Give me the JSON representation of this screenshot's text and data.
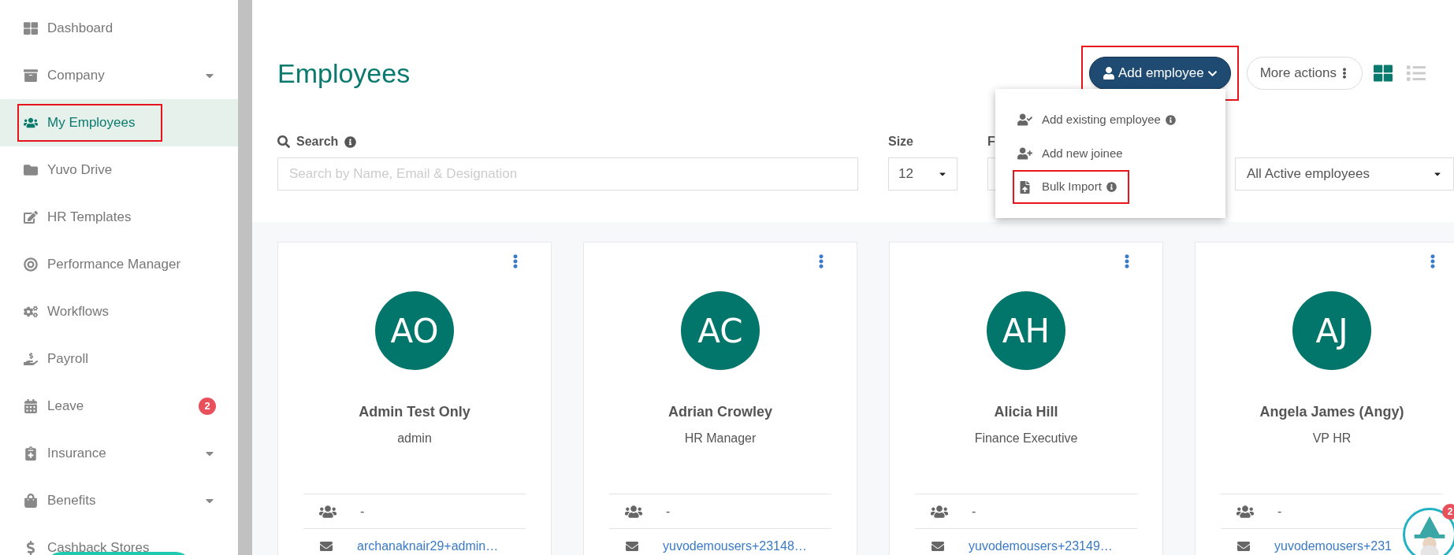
{
  "sidebar": {
    "items": [
      {
        "label": "Dashboard",
        "selected": false,
        "has_submenu": false,
        "highlighted": false
      },
      {
        "label": "Company",
        "selected": false,
        "has_submenu": true,
        "highlighted": false
      },
      {
        "label": "My Employees",
        "selected": true,
        "has_submenu": false,
        "highlighted": true
      },
      {
        "label": "Yuvo Drive",
        "selected": false,
        "has_submenu": false,
        "highlighted": false
      },
      {
        "label": "HR Templates",
        "selected": false,
        "has_submenu": false,
        "highlighted": false
      },
      {
        "label": "Performance Manager",
        "selected": false,
        "has_submenu": false,
        "highlighted": false
      },
      {
        "label": "Workflows",
        "selected": false,
        "has_submenu": false,
        "highlighted": false
      },
      {
        "label": "Payroll",
        "selected": false,
        "has_submenu": false,
        "highlighted": false
      },
      {
        "label": "Leave",
        "selected": false,
        "has_submenu": false,
        "highlighted": false,
        "badge": "2"
      },
      {
        "label": "Insurance",
        "selected": false,
        "has_submenu": true,
        "highlighted": false
      },
      {
        "label": "Benefits",
        "selected": false,
        "has_submenu": true,
        "highlighted": false
      },
      {
        "label": "Cashback Stores",
        "selected": false,
        "has_submenu": false,
        "highlighted": false
      }
    ]
  },
  "header": {
    "title": "Employees",
    "add_button": {
      "label": "Add employee",
      "highlighted": true,
      "expanded": true
    },
    "more_button": {
      "label": "More actions"
    },
    "view_modes": [
      {
        "selected": true
      },
      {
        "selected": false
      }
    ]
  },
  "menu": [
    {
      "label": "Add existing employee",
      "info": true,
      "highlighted": false
    },
    {
      "label": "Add new joinee",
      "info": false,
      "highlighted": false
    },
    {
      "label": "Bulk Import",
      "info": true,
      "highlighted": true
    }
  ],
  "filters": {
    "search_label": "Search",
    "search_placeholder": "Search by Name, Email & Designation",
    "size_label": "Size",
    "size_value": "12",
    "filter_label": "F",
    "status_value": "All Active employees"
  },
  "cards": [
    {
      "initials": "AO",
      "name": "Admin Test Only",
      "role": "admin",
      "team": "-",
      "email": "archanaknair29+admin…"
    },
    {
      "initials": "AC",
      "name": "Adrian Crowley",
      "role": "HR Manager",
      "team": "-",
      "email": "yuvodemousers+23148…"
    },
    {
      "initials": "AH",
      "name": "Alicia Hill",
      "role": "Finance Executive",
      "team": "-",
      "email": "yuvodemousers+23149…"
    },
    {
      "initials": "AJ",
      "name": "Angela James (Angy)",
      "role": "VP HR",
      "team": "-",
      "email": "yuvodemousers+231"
    }
  ],
  "assistant": {
    "badge": "2"
  }
}
